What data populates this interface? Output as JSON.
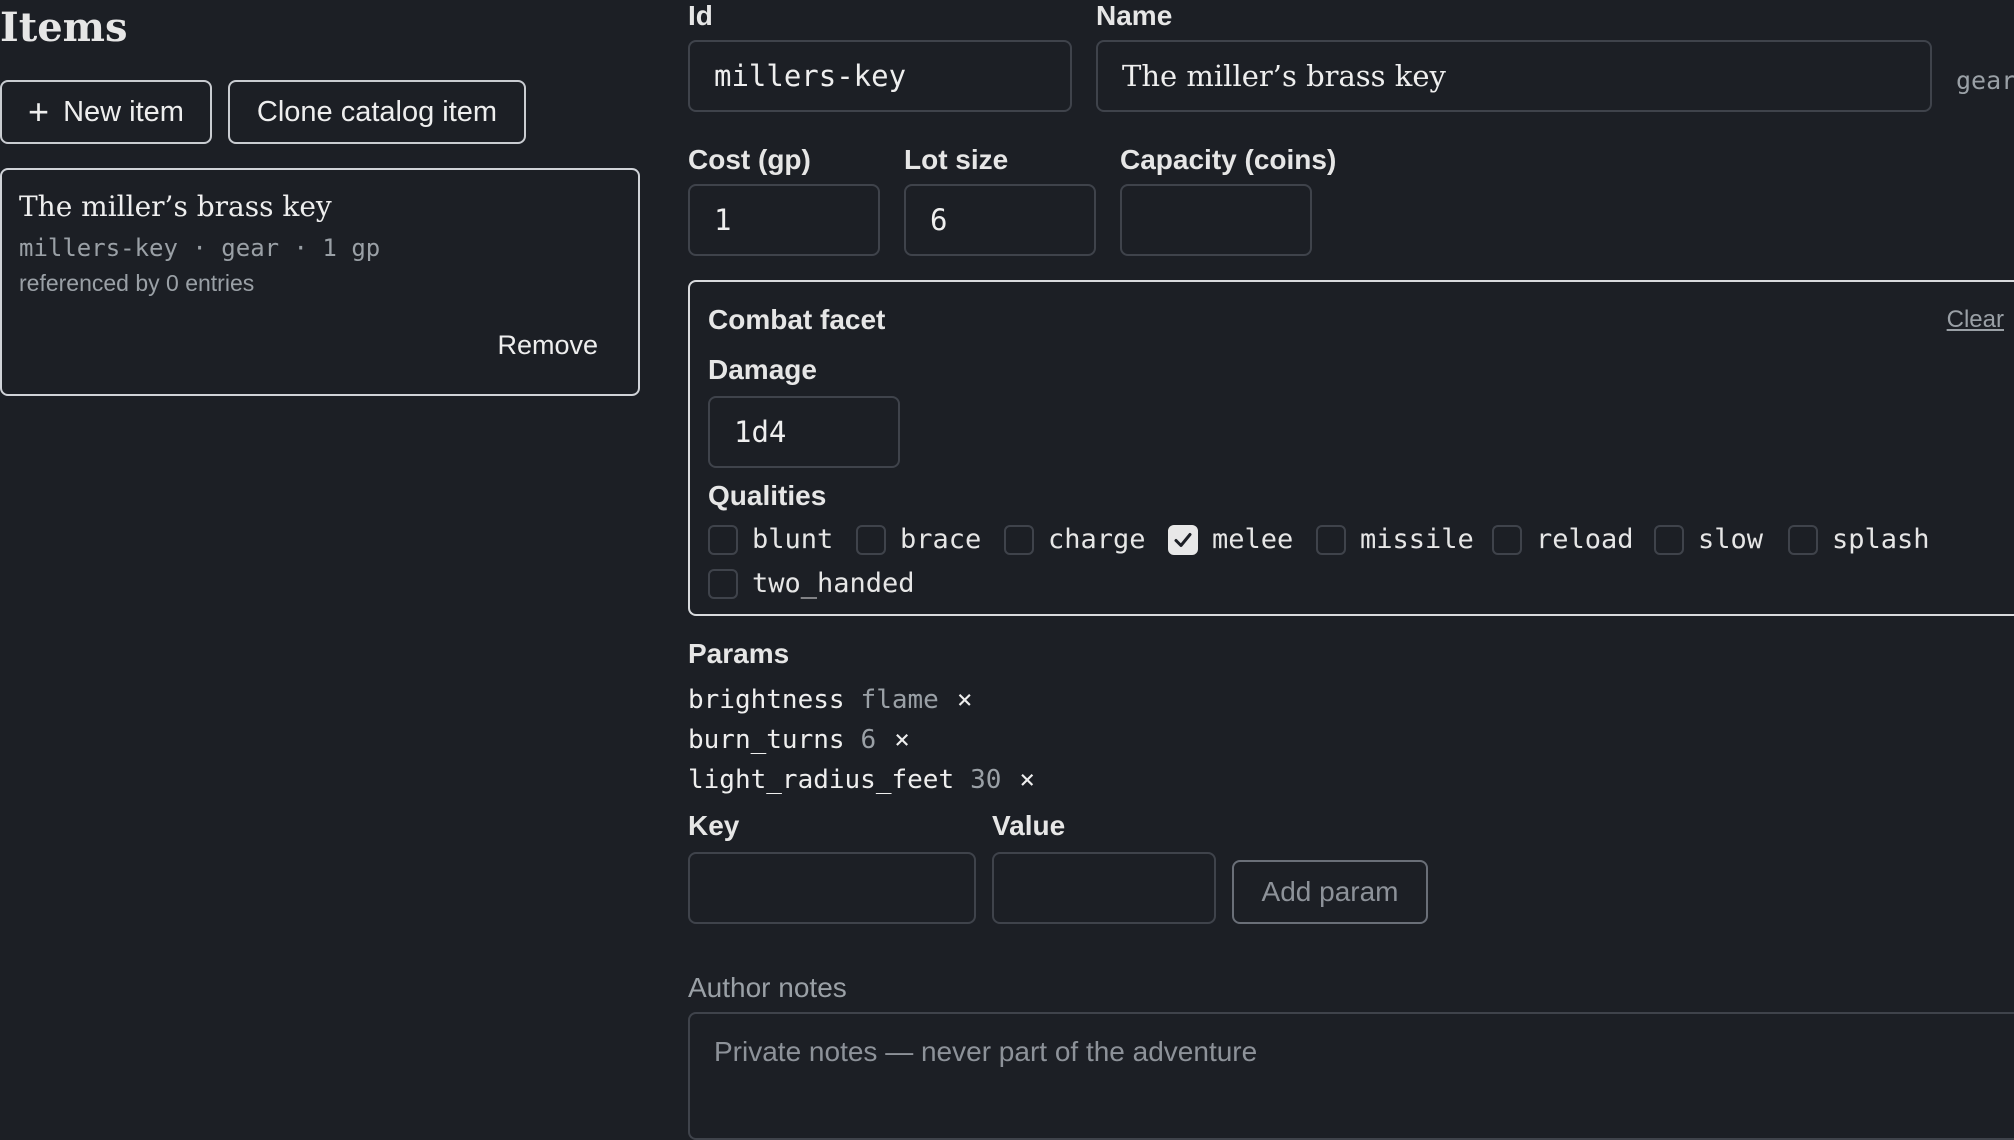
{
  "sidebar": {
    "title": "Items",
    "new_item_label": "New item",
    "clone_label": "Clone catalog item",
    "card": {
      "name": "The miller’s brass key",
      "meta": "millers-key · gear · 1 gp",
      "references": "referenced by 0 entries",
      "remove_label": "Remove"
    }
  },
  "form": {
    "id_label": "Id",
    "id_value": "millers-key",
    "name_label": "Name",
    "name_value": "The miller’s brass key",
    "type_hint": "gear",
    "cost_label": "Cost (gp)",
    "cost_value": "1",
    "lot_label": "Lot size",
    "lot_value": "6",
    "capacity_label": "Capacity (coins)",
    "capacity_value": ""
  },
  "combat": {
    "title": "Combat facet",
    "clear_label": "Clear",
    "damage_label": "Damage",
    "damage_value": "1d4",
    "qualities_label": "Qualities",
    "qualities": [
      {
        "label": "blunt",
        "checked": false
      },
      {
        "label": "brace",
        "checked": false
      },
      {
        "label": "charge",
        "checked": false
      },
      {
        "label": "melee",
        "checked": true
      },
      {
        "label": "missile",
        "checked": false
      },
      {
        "label": "reload",
        "checked": false
      },
      {
        "label": "slow",
        "checked": false
      },
      {
        "label": "splash",
        "checked": false
      },
      {
        "label": "two_handed",
        "checked": false
      }
    ]
  },
  "params": {
    "title": "Params",
    "items": [
      {
        "key": "brightness",
        "value": "flame"
      },
      {
        "key": "burn_turns",
        "value": "6"
      },
      {
        "key": "light_radius_feet",
        "value": "30"
      }
    ],
    "remove_glyph": "×",
    "key_label": "Key",
    "value_label": "Value",
    "add_label": "Add param"
  },
  "notes": {
    "label": "Author notes",
    "placeholder": "Private notes — never part of the adventure"
  }
}
